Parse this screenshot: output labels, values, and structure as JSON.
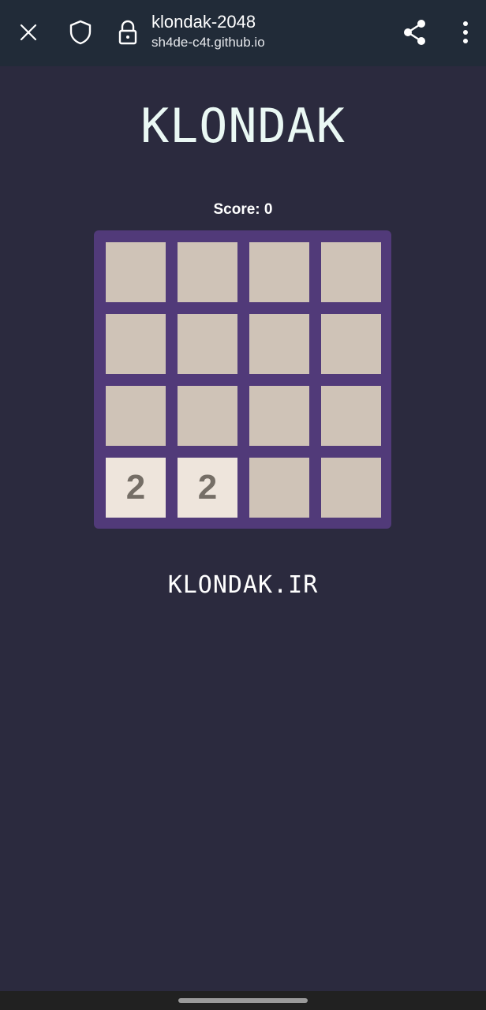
{
  "browser": {
    "page_title": "klondak-2048",
    "url": "sh4de-c4t.github.io",
    "icons": {
      "close": "close-icon",
      "shield": "shield-icon",
      "lock": "lock-icon",
      "share": "share-icon",
      "menu": "more-vert-icon"
    }
  },
  "game": {
    "title": "KLONDAK",
    "score_text": "Score: 0",
    "board": [
      [
        "",
        "",
        "",
        ""
      ],
      [
        "",
        "",
        "",
        ""
      ],
      [
        "",
        "",
        "",
        ""
      ],
      [
        "2",
        "2",
        "",
        ""
      ]
    ],
    "footer": "KLONDAK.IR"
  },
  "colors": {
    "background": "#2b2a3e",
    "topbar": "#212b38",
    "board": "#513a79",
    "empty_tile": "#cfc3b7",
    "tile_2": "#eee5dc",
    "tile_text": "#756e66"
  }
}
